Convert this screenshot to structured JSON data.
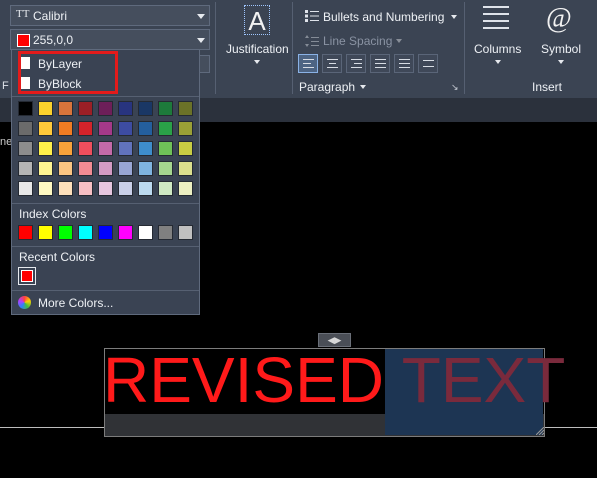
{
  "ribbon": {
    "font_value": "Calibri",
    "color_value": "255,0,0",
    "fragment_label": "F",
    "justification_label": "Justification",
    "bullets_label": "Bullets and Numbering",
    "line_spacing_label": "Line Spacing",
    "paragraph_label": "Paragraph",
    "columns_label": "Columns",
    "symbol_label": "Symbol",
    "symbol_glyph": "@",
    "justification_glyph": "A",
    "insert_label": "Insert"
  },
  "color_dropdown": {
    "bylayer_label": "ByLayer",
    "byblock_label": "ByBlock",
    "palette_rows": [
      [
        "#000000",
        "#fbd12c",
        "#d8743b",
        "#9b1f26",
        "#6d1f59",
        "#28347f",
        "#1a3765",
        "#1d7a3b",
        "#6b7228"
      ],
      [
        "#6b6b6b",
        "#ffc93a",
        "#f07c23",
        "#d3232b",
        "#a43989",
        "#3d4ca2",
        "#245f9e",
        "#2aa148",
        "#9aa036"
      ],
      [
        "#8d8d8d",
        "#fff04a",
        "#f8a23a",
        "#ee4e5d",
        "#c46aa9",
        "#6173bd",
        "#3e8dcc",
        "#6fc158",
        "#c8cd43"
      ],
      [
        "#b5b5b5",
        "#fff592",
        "#fbc582",
        "#f28b93",
        "#d39bc4",
        "#98a6d5",
        "#7fb4e0",
        "#a5d68f",
        "#dbdf8d"
      ],
      [
        "#e8e8e8",
        "#fff9c2",
        "#fde0bb",
        "#f7bfc4",
        "#e6c6df",
        "#c9cfe8",
        "#bcdaf0",
        "#cfe9c3",
        "#ecefc1"
      ]
    ],
    "index_colors_label": "Index Colors",
    "index_colors": [
      "#ff0000",
      "#ffff00",
      "#00ff00",
      "#00ffff",
      "#0000ff",
      "#ff00ff",
      "#ffffff",
      "#808080",
      "#c0c0c0"
    ],
    "recent_colors_label": "Recent Colors",
    "recent_colors": [
      "#ff0000"
    ],
    "more_colors_label": "More Colors..."
  },
  "canvas": {
    "text_revised": "REVISED",
    "text_selected": "TEXT",
    "text_color": "#ff0000",
    "selection_handle": "◀▶",
    "edge_fragment": "ne"
  }
}
